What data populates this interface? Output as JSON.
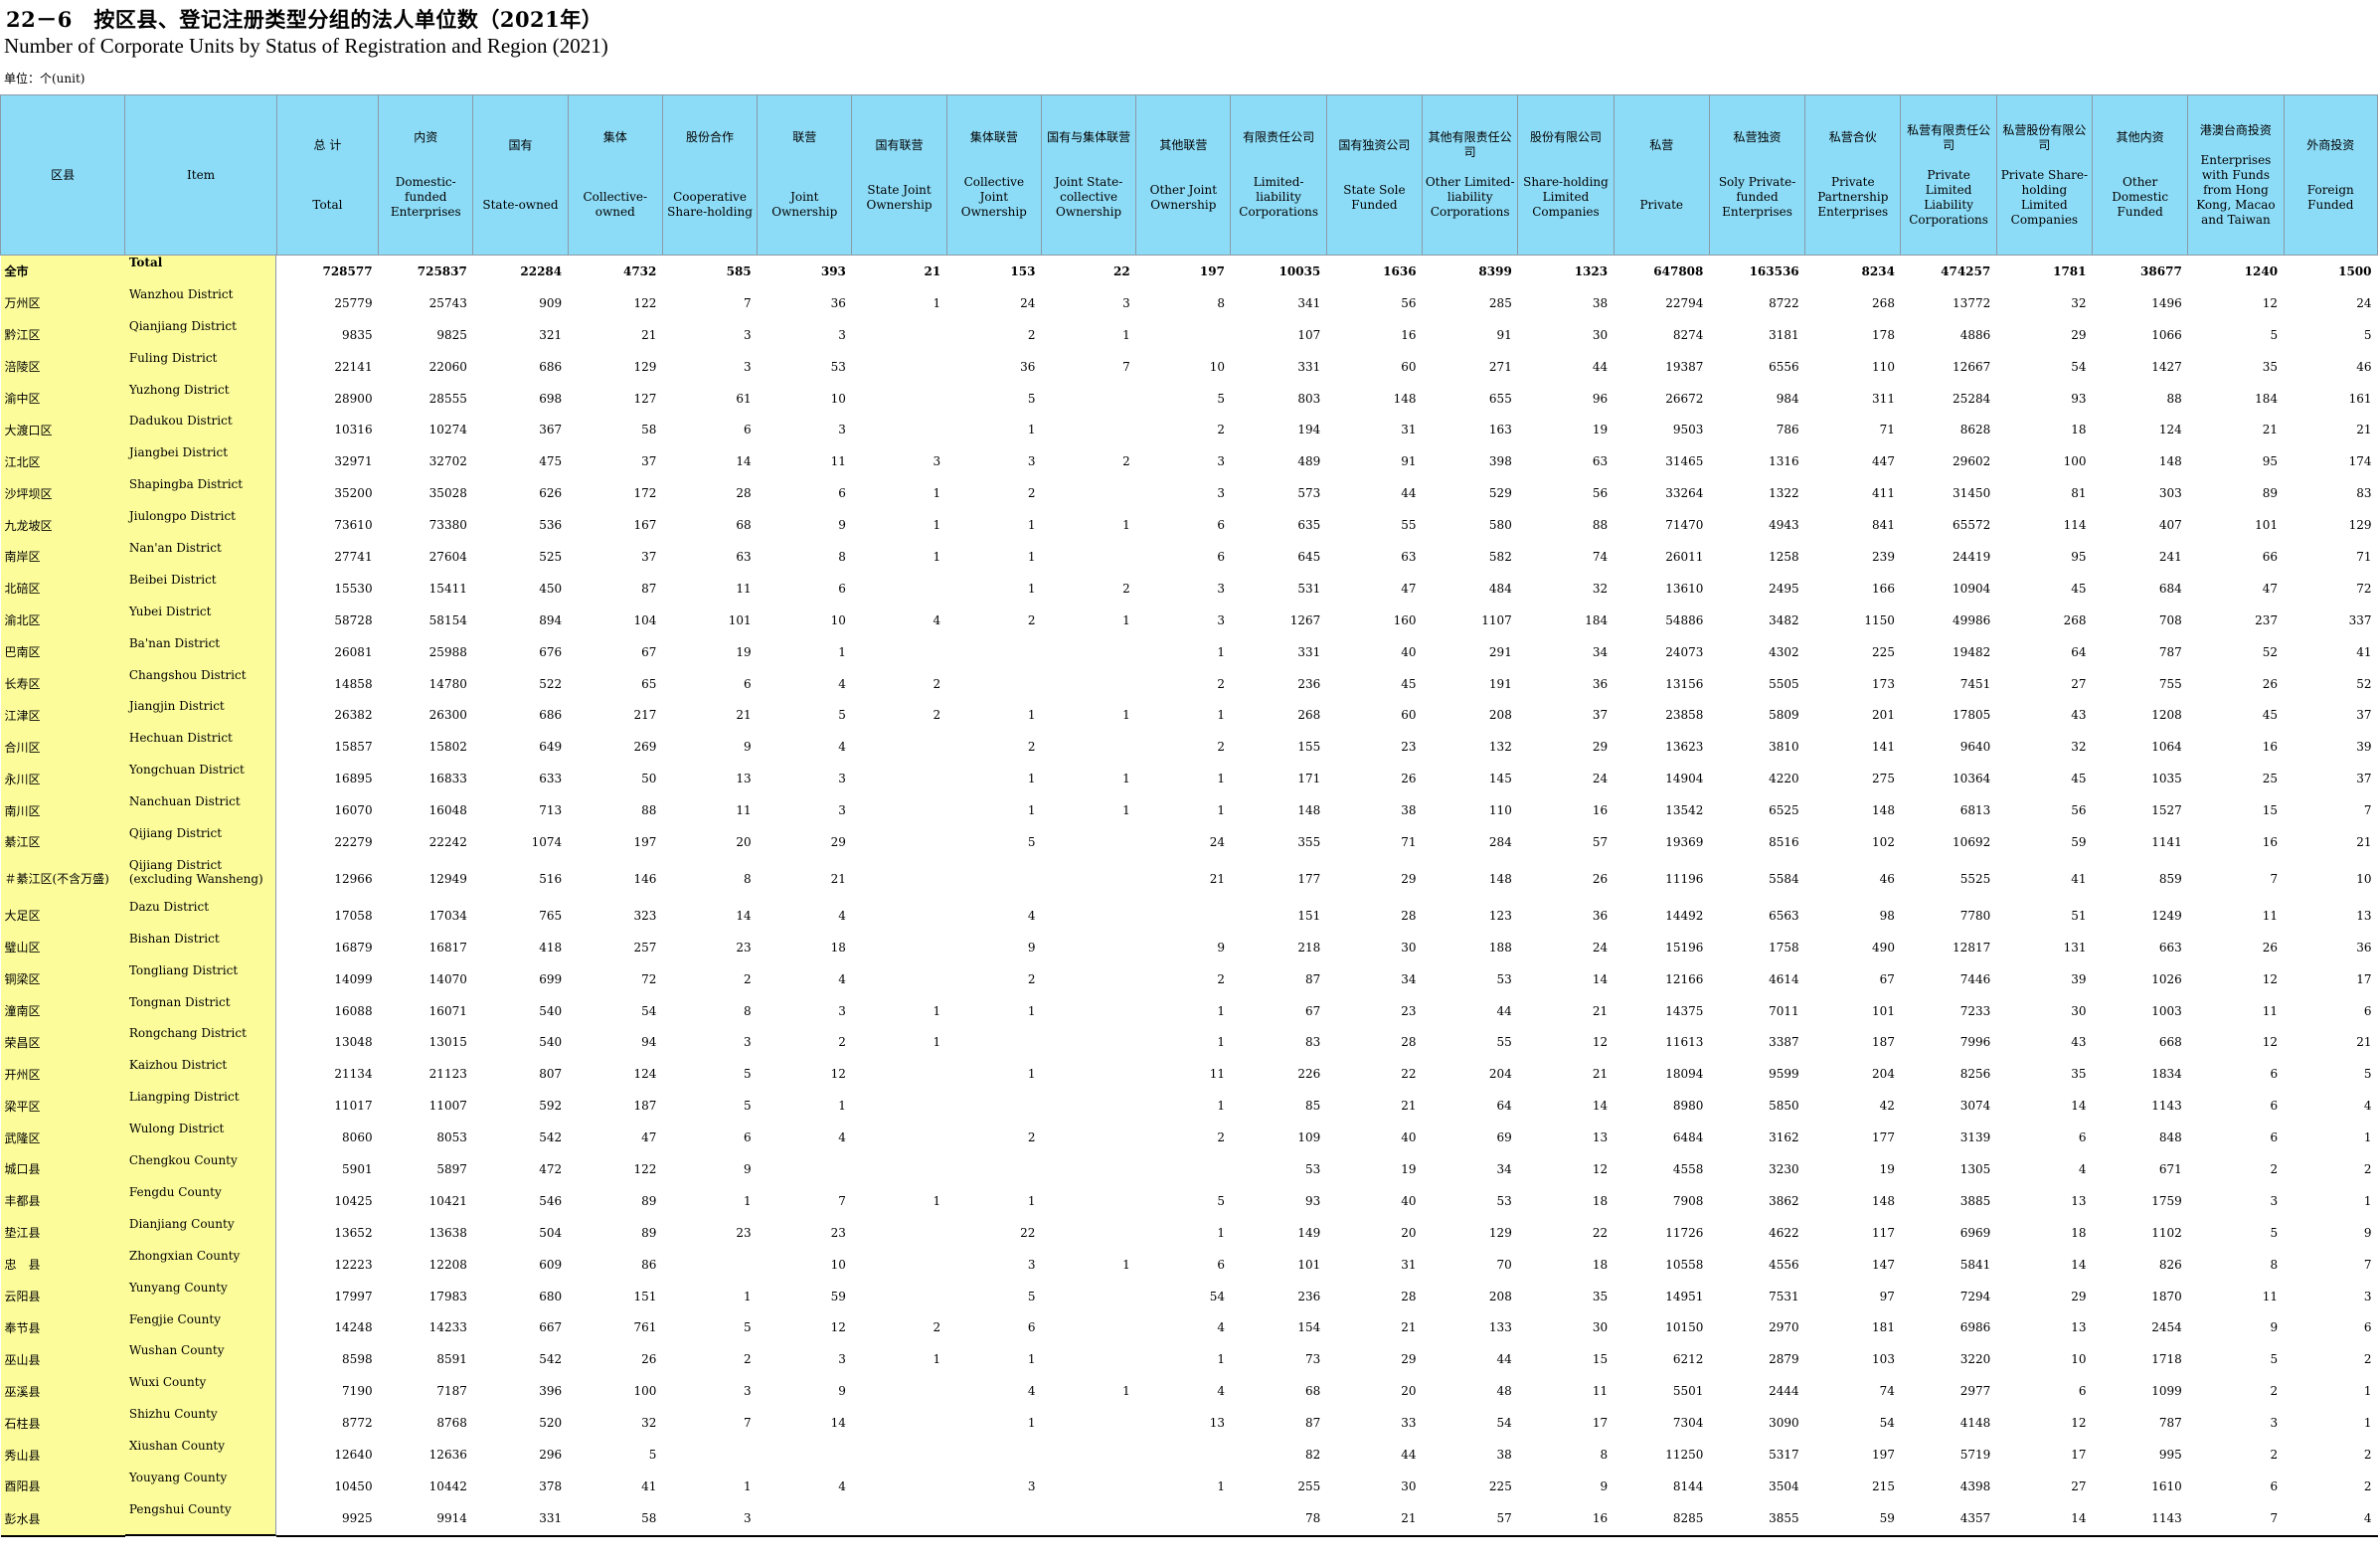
{
  "title_cn": "22－6　按区县、登记注册类型分组的法人单位数（2021年）",
  "title_en": "Number of Corporate Units by Status of Registration and Region (2021)",
  "unit": "单位：个(unit)",
  "header": {
    "region_cn": "区县",
    "item_en": "Item",
    "total_cn": "总 计",
    "total_en": "Total",
    "domestic_cn": "内资",
    "domestic_en": "Domestic-funded Enterprises",
    "state_cn": "国有",
    "state_en": "State-owned",
    "collective_cn": "集体",
    "collective_en": "Collective-owned",
    "coop_cn": "股份合作",
    "coop_en": "Cooperative Share-holding",
    "joint_cn": "联营",
    "joint_en": "Joint Ownership",
    "sj_cn": "国有联营",
    "sj_en": "State Joint Ownership",
    "cj_cn": "集体联营",
    "cj_en": "Collective Joint Ownership",
    "scj_cn": "国有与集体联营",
    "scj_en": "Joint State-collective Ownership",
    "oj_cn": "其他联营",
    "oj_en": "Other Joint Ownership",
    "ll_cn": "有限责任公司",
    "ll_en": "Limited-liability Corporations",
    "ssf_cn": "国有独资公司",
    "ssf_en": "State Sole Funded",
    "oll_cn": "其他有限责任公司",
    "oll_en": "Other Limited-liability Corporations",
    "sh_cn": "股份有限公司",
    "sh_en": "Share-holding Limited Companies",
    "priv_cn": "私营",
    "priv_en": "Private",
    "spf_cn": "私营独资",
    "spf_en": "Soly Private-funded Enterprises",
    "pp_cn": "私营合伙",
    "pp_en": "Private Partnership Enterprises",
    "pll_cn": "私营有限责任公司",
    "pll_en": "Private Limited Liability Corporations",
    "psh_cn": "私营股份有限公司",
    "psh_en": "Private Share-holding Limited Companies",
    "odf_cn": "其他内资",
    "odf_en": "Other Domestic Funded",
    "hkmt_cn": "港澳台商投资",
    "hkmt_en": "Enterprises with Funds from Hong Kong, Macao and Taiwan",
    "foreign_cn": "外商投资",
    "foreign_en": "Foreign Funded"
  },
  "rows": [
    {
      "cn": "全市",
      "en": "Total",
      "v": [
        "728577",
        "725837",
        "22284",
        "4732",
        "585",
        "393",
        "21",
        "153",
        "22",
        "197",
        "10035",
        "1636",
        "8399",
        "1323",
        "647808",
        "163536",
        "8234",
        "474257",
        "1781",
        "38677",
        "1240",
        "1500"
      ]
    },
    {
      "cn": "万州区",
      "en": "Wanzhou District",
      "v": [
        "25779",
        "25743",
        "909",
        "122",
        "7",
        "36",
        "1",
        "24",
        "3",
        "8",
        "341",
        "56",
        "285",
        "38",
        "22794",
        "8722",
        "268",
        "13772",
        "32",
        "1496",
        "12",
        "24"
      ]
    },
    {
      "cn": "黔江区",
      "en": "Qianjiang District",
      "v": [
        "9835",
        "9825",
        "321",
        "21",
        "3",
        "3",
        "",
        "2",
        "1",
        "",
        "107",
        "16",
        "91",
        "30",
        "8274",
        "3181",
        "178",
        "4886",
        "29",
        "1066",
        "5",
        "5"
      ]
    },
    {
      "cn": "涪陵区",
      "en": "Fuling District",
      "v": [
        "22141",
        "22060",
        "686",
        "129",
        "3",
        "53",
        "",
        "36",
        "7",
        "10",
        "331",
        "60",
        "271",
        "44",
        "19387",
        "6556",
        "110",
        "12667",
        "54",
        "1427",
        "35",
        "46"
      ]
    },
    {
      "cn": "渝中区",
      "en": "Yuzhong District",
      "v": [
        "28900",
        "28555",
        "698",
        "127",
        "61",
        "10",
        "",
        "5",
        "",
        "5",
        "803",
        "148",
        "655",
        "96",
        "26672",
        "984",
        "311",
        "25284",
        "93",
        "88",
        "184",
        "161"
      ]
    },
    {
      "cn": "大渡口区",
      "en": "Dadukou District",
      "v": [
        "10316",
        "10274",
        "367",
        "58",
        "6",
        "3",
        "",
        "1",
        "",
        "2",
        "194",
        "31",
        "163",
        "19",
        "9503",
        "786",
        "71",
        "8628",
        "18",
        "124",
        "21",
        "21"
      ]
    },
    {
      "cn": "江北区",
      "en": "Jiangbei District",
      "v": [
        "32971",
        "32702",
        "475",
        "37",
        "14",
        "11",
        "3",
        "3",
        "2",
        "3",
        "489",
        "91",
        "398",
        "63",
        "31465",
        "1316",
        "447",
        "29602",
        "100",
        "148",
        "95",
        "174"
      ]
    },
    {
      "cn": "沙坪坝区",
      "en": "Shapingba District",
      "v": [
        "35200",
        "35028",
        "626",
        "172",
        "28",
        "6",
        "1",
        "2",
        "",
        "3",
        "573",
        "44",
        "529",
        "56",
        "33264",
        "1322",
        "411",
        "31450",
        "81",
        "303",
        "89",
        "83"
      ]
    },
    {
      "cn": "九龙坡区",
      "en": "Jiulongpo District",
      "v": [
        "73610",
        "73380",
        "536",
        "167",
        "68",
        "9",
        "1",
        "1",
        "1",
        "6",
        "635",
        "55",
        "580",
        "88",
        "71470",
        "4943",
        "841",
        "65572",
        "114",
        "407",
        "101",
        "129"
      ]
    },
    {
      "cn": "南岸区",
      "en": "Nan'an District",
      "v": [
        "27741",
        "27604",
        "525",
        "37",
        "63",
        "8",
        "1",
        "1",
        "",
        "6",
        "645",
        "63",
        "582",
        "74",
        "26011",
        "1258",
        "239",
        "24419",
        "95",
        "241",
        "66",
        "71"
      ]
    },
    {
      "cn": "北碚区",
      "en": "Beibei District",
      "v": [
        "15530",
        "15411",
        "450",
        "87",
        "11",
        "6",
        "",
        "1",
        "2",
        "3",
        "531",
        "47",
        "484",
        "32",
        "13610",
        "2495",
        "166",
        "10904",
        "45",
        "684",
        "47",
        "72"
      ]
    },
    {
      "cn": "渝北区",
      "en": "Yubei District",
      "v": [
        "58728",
        "58154",
        "894",
        "104",
        "101",
        "10",
        "4",
        "2",
        "1",
        "3",
        "1267",
        "160",
        "1107",
        "184",
        "54886",
        "3482",
        "1150",
        "49986",
        "268",
        "708",
        "237",
        "337"
      ]
    },
    {
      "cn": "巴南区",
      "en": "Ba'nan District",
      "v": [
        "26081",
        "25988",
        "676",
        "67",
        "19",
        "1",
        "",
        "",
        "",
        "1",
        "331",
        "40",
        "291",
        "34",
        "24073",
        "4302",
        "225",
        "19482",
        "64",
        "787",
        "52",
        "41"
      ]
    },
    {
      "cn": "长寿区",
      "en": "Changshou District",
      "v": [
        "14858",
        "14780",
        "522",
        "65",
        "6",
        "4",
        "2",
        "",
        "",
        "2",
        "236",
        "45",
        "191",
        "36",
        "13156",
        "5505",
        "173",
        "7451",
        "27",
        "755",
        "26",
        "52"
      ]
    },
    {
      "cn": "江津区",
      "en": "Jiangjin District",
      "v": [
        "26382",
        "26300",
        "686",
        "217",
        "21",
        "5",
        "2",
        "1",
        "1",
        "1",
        "268",
        "60",
        "208",
        "37",
        "23858",
        "5809",
        "201",
        "17805",
        "43",
        "1208",
        "45",
        "37"
      ]
    },
    {
      "cn": "合川区",
      "en": "Hechuan District",
      "v": [
        "15857",
        "15802",
        "649",
        "269",
        "9",
        "4",
        "",
        "2",
        "",
        "2",
        "155",
        "23",
        "132",
        "29",
        "13623",
        "3810",
        "141",
        "9640",
        "32",
        "1064",
        "16",
        "39"
      ]
    },
    {
      "cn": "永川区",
      "en": "Yongchuan District",
      "v": [
        "16895",
        "16833",
        "633",
        "50",
        "13",
        "3",
        "",
        "1",
        "1",
        "1",
        "171",
        "26",
        "145",
        "24",
        "14904",
        "4220",
        "275",
        "10364",
        "45",
        "1035",
        "25",
        "37"
      ]
    },
    {
      "cn": "南川区",
      "en": "Nanchuan District",
      "v": [
        "16070",
        "16048",
        "713",
        "88",
        "11",
        "3",
        "",
        "1",
        "1",
        "1",
        "148",
        "38",
        "110",
        "16",
        "13542",
        "6525",
        "148",
        "6813",
        "56",
        "1527",
        "15",
        "7"
      ]
    },
    {
      "cn": "綦江区",
      "en": "Qijiang District",
      "v": [
        "22279",
        "22242",
        "1074",
        "197",
        "20",
        "29",
        "",
        "5",
        "",
        "24",
        "355",
        "71",
        "284",
        "57",
        "19369",
        "8516",
        "102",
        "10692",
        "59",
        "1141",
        "16",
        "21"
      ]
    },
    {
      "cn": "＃綦江区(不含万盛)",
      "en": "Qijiang District (excluding Wansheng)",
      "v": [
        "12966",
        "12949",
        "516",
        "146",
        "8",
        "21",
        "",
        "",
        "",
        "21",
        "177",
        "29",
        "148",
        "26",
        "11196",
        "5584",
        "46",
        "5525",
        "41",
        "859",
        "7",
        "10"
      ],
      "tall": true
    },
    {
      "cn": "大足区",
      "en": "Dazu District",
      "v": [
        "17058",
        "17034",
        "765",
        "323",
        "14",
        "4",
        "",
        "4",
        "",
        "",
        "151",
        "28",
        "123",
        "36",
        "14492",
        "6563",
        "98",
        "7780",
        "51",
        "1249",
        "11",
        "13"
      ]
    },
    {
      "cn": "璧山区",
      "en": "Bishan District",
      "v": [
        "16879",
        "16817",
        "418",
        "257",
        "23",
        "18",
        "",
        "9",
        "",
        "9",
        "218",
        "30",
        "188",
        "24",
        "15196",
        "1758",
        "490",
        "12817",
        "131",
        "663",
        "26",
        "36"
      ]
    },
    {
      "cn": "铜梁区",
      "en": "Tongliang District",
      "v": [
        "14099",
        "14070",
        "699",
        "72",
        "2",
        "4",
        "",
        "2",
        "",
        "2",
        "87",
        "34",
        "53",
        "14",
        "12166",
        "4614",
        "67",
        "7446",
        "39",
        "1026",
        "12",
        "17"
      ]
    },
    {
      "cn": "潼南区",
      "en": "Tongnan District",
      "v": [
        "16088",
        "16071",
        "540",
        "54",
        "8",
        "3",
        "1",
        "1",
        "",
        "1",
        "67",
        "23",
        "44",
        "21",
        "14375",
        "7011",
        "101",
        "7233",
        "30",
        "1003",
        "11",
        "6"
      ]
    },
    {
      "cn": "荣昌区",
      "en": "Rongchang District",
      "v": [
        "13048",
        "13015",
        "540",
        "94",
        "3",
        "2",
        "1",
        "",
        "",
        "1",
        "83",
        "28",
        "55",
        "12",
        "11613",
        "3387",
        "187",
        "7996",
        "43",
        "668",
        "12",
        "21"
      ]
    },
    {
      "cn": "开州区",
      "en": "Kaizhou District",
      "v": [
        "21134",
        "21123",
        "807",
        "124",
        "5",
        "12",
        "",
        "1",
        "",
        "11",
        "226",
        "22",
        "204",
        "21",
        "18094",
        "9599",
        "204",
        "8256",
        "35",
        "1834",
        "6",
        "5"
      ]
    },
    {
      "cn": "梁平区",
      "en": "Liangping District",
      "v": [
        "11017",
        "11007",
        "592",
        "187",
        "5",
        "1",
        "",
        "",
        "",
        "1",
        "85",
        "21",
        "64",
        "14",
        "8980",
        "5850",
        "42",
        "3074",
        "14",
        "1143",
        "6",
        "4"
      ]
    },
    {
      "cn": "武隆区",
      "en": "Wulong District",
      "v": [
        "8060",
        "8053",
        "542",
        "47",
        "6",
        "4",
        "",
        "2",
        "",
        "2",
        "109",
        "40",
        "69",
        "13",
        "6484",
        "3162",
        "177",
        "3139",
        "6",
        "848",
        "6",
        "1"
      ]
    },
    {
      "cn": "城口县",
      "en": "Chengkou County",
      "v": [
        "5901",
        "5897",
        "472",
        "122",
        "9",
        "",
        "",
        "",
        "",
        "",
        "53",
        "19",
        "34",
        "12",
        "4558",
        "3230",
        "19",
        "1305",
        "4",
        "671",
        "2",
        "2"
      ]
    },
    {
      "cn": "丰都县",
      "en": "Fengdu County",
      "v": [
        "10425",
        "10421",
        "546",
        "89",
        "1",
        "7",
        "1",
        "1",
        "",
        "5",
        "93",
        "40",
        "53",
        "18",
        "7908",
        "3862",
        "148",
        "3885",
        "13",
        "1759",
        "3",
        "1"
      ]
    },
    {
      "cn": "垫江县",
      "en": "Dianjiang County",
      "v": [
        "13652",
        "13638",
        "504",
        "89",
        "23",
        "23",
        "",
        "22",
        "",
        "1",
        "149",
        "20",
        "129",
        "22",
        "11726",
        "4622",
        "117",
        "6969",
        "18",
        "1102",
        "5",
        "9"
      ]
    },
    {
      "cn": "忠　县",
      "en": "Zhongxian County",
      "v": [
        "12223",
        "12208",
        "609",
        "86",
        "",
        "10",
        "",
        "3",
        "1",
        "6",
        "101",
        "31",
        "70",
        "18",
        "10558",
        "4556",
        "147",
        "5841",
        "14",
        "826",
        "8",
        "7"
      ]
    },
    {
      "cn": "云阳县",
      "en": "Yunyang County",
      "v": [
        "17997",
        "17983",
        "680",
        "151",
        "1",
        "59",
        "",
        "5",
        "",
        "54",
        "236",
        "28",
        "208",
        "35",
        "14951",
        "7531",
        "97",
        "7294",
        "29",
        "1870",
        "11",
        "3"
      ]
    },
    {
      "cn": "奉节县",
      "en": "Fengjie County",
      "v": [
        "14248",
        "14233",
        "667",
        "761",
        "5",
        "12",
        "2",
        "6",
        "",
        "4",
        "154",
        "21",
        "133",
        "30",
        "10150",
        "2970",
        "181",
        "6986",
        "13",
        "2454",
        "9",
        "6"
      ]
    },
    {
      "cn": "巫山县",
      "en": "Wushan County",
      "v": [
        "8598",
        "8591",
        "542",
        "26",
        "2",
        "3",
        "1",
        "1",
        "",
        "1",
        "73",
        "29",
        "44",
        "15",
        "6212",
        "2879",
        "103",
        "3220",
        "10",
        "1718",
        "5",
        "2"
      ]
    },
    {
      "cn": "巫溪县",
      "en": "Wuxi County",
      "v": [
        "7190",
        "7187",
        "396",
        "100",
        "3",
        "9",
        "",
        "4",
        "1",
        "4",
        "68",
        "20",
        "48",
        "11",
        "5501",
        "2444",
        "74",
        "2977",
        "6",
        "1099",
        "2",
        "1"
      ]
    },
    {
      "cn": "石柱县",
      "en": "Shizhu County",
      "v": [
        "8772",
        "8768",
        "520",
        "32",
        "7",
        "14",
        "",
        "1",
        "",
        "13",
        "87",
        "33",
        "54",
        "17",
        "7304",
        "3090",
        "54",
        "4148",
        "12",
        "787",
        "3",
        "1"
      ]
    },
    {
      "cn": "秀山县",
      "en": "Xiushan County",
      "v": [
        "12640",
        "12636",
        "296",
        "5",
        "",
        "",
        "",
        "",
        "",
        "",
        "82",
        "44",
        "38",
        "8",
        "11250",
        "5317",
        "197",
        "5719",
        "17",
        "995",
        "2",
        "2"
      ]
    },
    {
      "cn": "酉阳县",
      "en": "Youyang County",
      "v": [
        "10450",
        "10442",
        "378",
        "41",
        "1",
        "4",
        "",
        "3",
        "",
        "1",
        "255",
        "30",
        "225",
        "9",
        "8144",
        "3504",
        "215",
        "4398",
        "27",
        "1610",
        "6",
        "2"
      ]
    },
    {
      "cn": "彭水县",
      "en": "Pengshui County",
      "v": [
        "9925",
        "9914",
        "331",
        "58",
        "3",
        "",
        "",
        "",
        "",
        "",
        "78",
        "21",
        "57",
        "16",
        "8285",
        "3855",
        "59",
        "4357",
        "14",
        "1143",
        "7",
        "4"
      ]
    }
  ]
}
